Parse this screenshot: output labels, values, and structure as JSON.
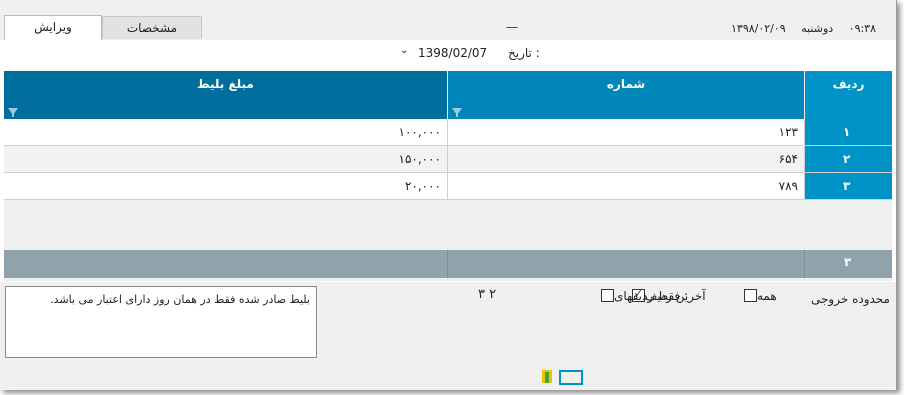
{
  "window": {
    "time": "۰۹:۳۸",
    "weekday": "دوشنبه",
    "date": "۱۳۹۸/۰۲/۰۹",
    "tab_placeholder": "—"
  },
  "tabs": [
    {
      "label": "ویرایش"
    },
    {
      "label": "مشخصات"
    }
  ],
  "date_filter": {
    "label": "تاریخ :",
    "value": "1398/02/07"
  },
  "table": {
    "columns": [
      "ردیف",
      "شماره",
      "مبلغ بلیط"
    ],
    "rows": [
      {
        "index": "۱",
        "number": "۱۲۳",
        "amount": "۱۰۰,۰۰۰"
      },
      {
        "index": "۲",
        "number": "۶۵۴",
        "amount": "۱۵۰,۰۰۰"
      },
      {
        "index": "۳",
        "number": "۷۸۹",
        "amount": "۲۰,۰۰۰"
      }
    ],
    "footer_count": "۳"
  },
  "note": {
    "text": "بلیط صادر شده فقط در همان روز دارای اعتبار می باشد."
  },
  "output_range": {
    "label": "محدوده خروجی",
    "all_label": "همه",
    "all_checked": false,
    "last_row_label": "آخرین ردیف",
    "last_row_checked": true,
    "only_rows_label": "فقط ردیفهای :",
    "only_rows_checked": false,
    "only_rows_value": "۳ ۲"
  },
  "colors": {
    "header_dark": "#006e9c",
    "header_mid": "#0086b8",
    "row_index": "#0093c8",
    "footer": "#8fa3ad"
  }
}
